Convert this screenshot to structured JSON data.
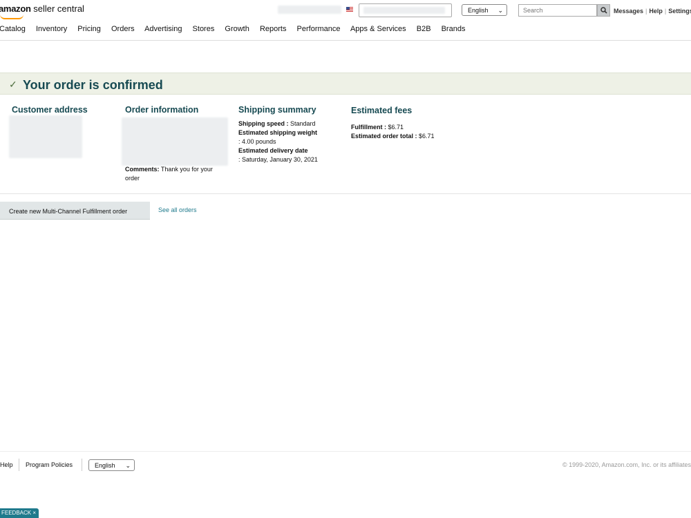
{
  "header": {
    "logo_brand": "amazon",
    "logo_product": "seller central",
    "language": "English",
    "search_placeholder": "Search",
    "links": [
      "Messages",
      "Help",
      "Settings"
    ]
  },
  "nav": [
    "Catalog",
    "Inventory",
    "Pricing",
    "Orders",
    "Advertising",
    "Stores",
    "Growth",
    "Reports",
    "Performance",
    "Apps & Services",
    "B2B",
    "Brands"
  ],
  "banner": {
    "title": "Your order is confirmed"
  },
  "sections": {
    "customer_address": {
      "heading": "Customer address"
    },
    "order_information": {
      "heading": "Order information",
      "comments_label": "Comments:",
      "comments_value": " Thank you for your order"
    },
    "shipping_summary": {
      "heading": "Shipping summary",
      "speed_label": "Shipping speed :",
      "speed_value": " Standard",
      "weight_label": "Estimated shipping weight",
      "weight_value": ": 4.00 pounds",
      "delivery_label": "Estimated delivery date",
      "delivery_value": ": Saturday, January 30, 2021"
    },
    "estimated_fees": {
      "heading": "Estimated fees",
      "fulfillment_label": "Fulfillment :",
      "fulfillment_value": " $6.71",
      "total_label": "Estimated order total :",
      "total_value": " $6.71"
    }
  },
  "actions": {
    "create_button": "Create new Multi-Channel Fulfillment order",
    "see_all_link": "See all orders"
  },
  "footer": {
    "help": "Help",
    "policies": "Program Policies",
    "language": "English",
    "copyright": "© 1999-2020, Amazon.com, Inc. or its affiliates"
  },
  "feedback": "FEEDBACK ×",
  "colors": {
    "accent": "#174a52",
    "banner_bg": "#eef1e6",
    "link": "#1f7a8c",
    "logo_smile": "#ff9900"
  }
}
